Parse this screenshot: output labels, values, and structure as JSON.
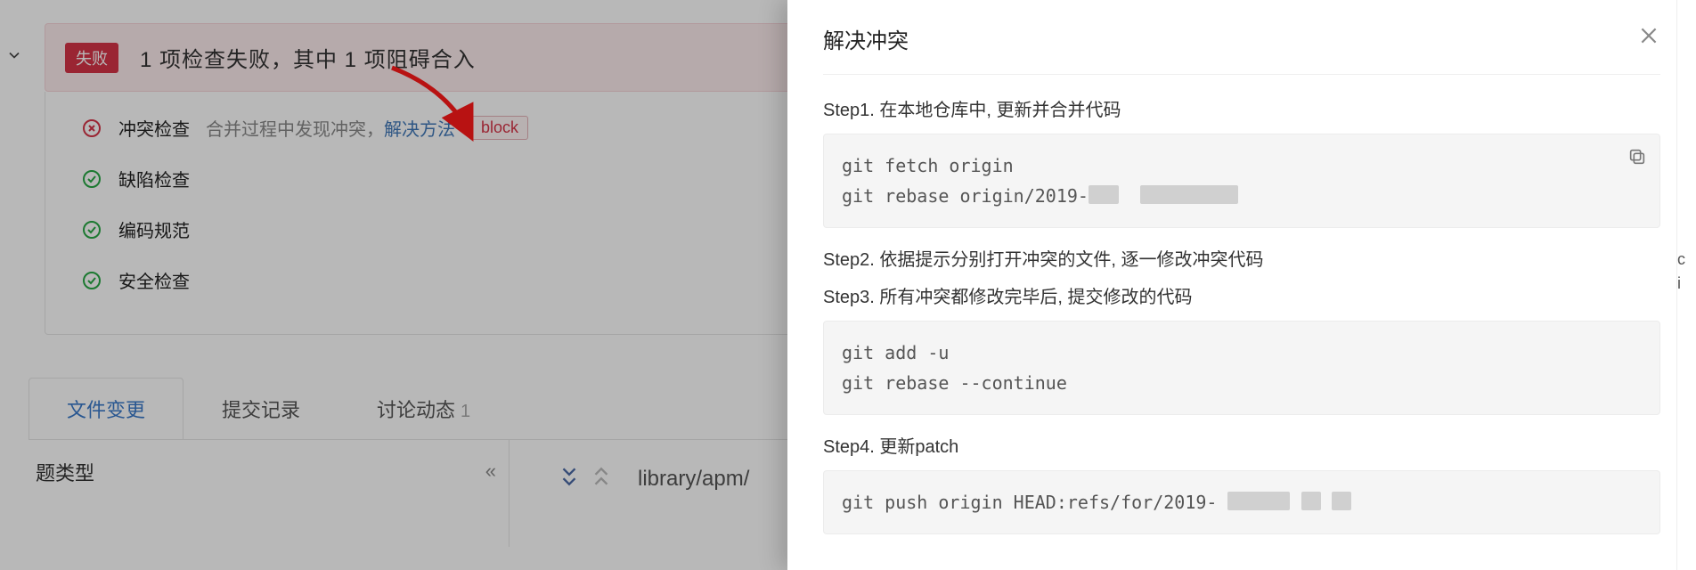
{
  "status_bar": {
    "badge": "失败",
    "title": "1 项检查失败，其中 1 项阻碍合入"
  },
  "checks": {
    "items": [
      {
        "name": "冲突检查",
        "detail_prefix": "合并过程中发现冲突，",
        "link_label": "解决方法",
        "block_label": "block",
        "status": "fail"
      },
      {
        "name": "缺陷检查",
        "status": "pass"
      },
      {
        "name": "编码规范",
        "status": "pass"
      },
      {
        "name": "安全检查",
        "status": "pass"
      }
    ]
  },
  "tabs": {
    "items": [
      {
        "label": "文件变更",
        "active": true
      },
      {
        "label": "提交记录",
        "active": false
      },
      {
        "label": "讨论动态",
        "count": "1",
        "active": false
      }
    ]
  },
  "file_tree": {
    "heading": "题类型",
    "collapse_glyph": "«"
  },
  "file_view": {
    "path_prefix": "library/apm/"
  },
  "drawer": {
    "title": "解决冲突",
    "step1": "Step1. 在本地仓库中, 更新并合并代码",
    "code1_line1": "git fetch origin",
    "code1_line2_prefix": "git rebase origin/2019-",
    "step2": "Step2. 依据提示分别打开冲突的文件, 逐一修改冲突代码",
    "step3": "Step3. 所有冲突都修改完毕后, 提交修改的代码",
    "code2": "git add -u\ngit rebase --continue",
    "step4": "Step4. 更新patch",
    "code3_prefix": "git push origin HEAD:refs/for/2019-"
  },
  "side_strip": {
    "char1": "c",
    "char2": "i"
  }
}
